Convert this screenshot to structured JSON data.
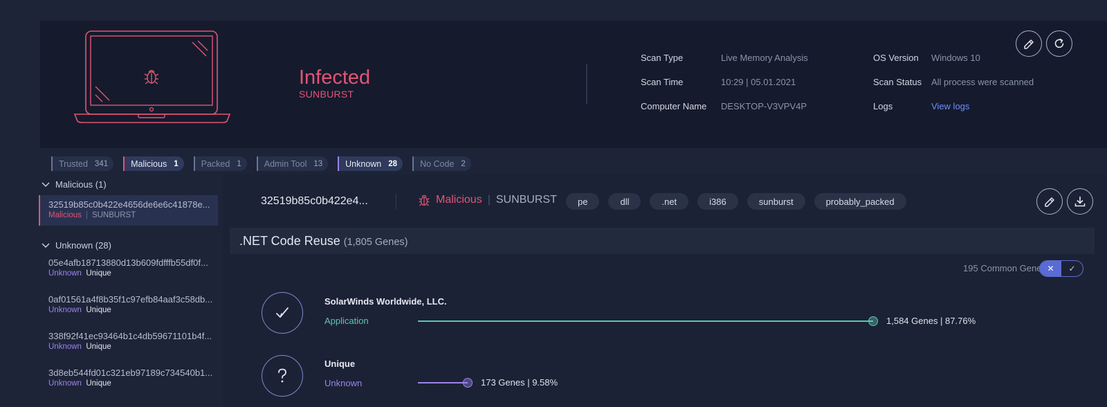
{
  "scan": {
    "verdict": "Infected",
    "family": "SUNBURST",
    "fields": {
      "scan_type_label": "Scan Type",
      "scan_type_value": "Live Memory Analysis",
      "scan_time_label": "Scan Time",
      "scan_time_value": "10:29 | 05.01.2021",
      "computer_name_label": "Computer Name",
      "computer_name_value": "DESKTOP-V3VPV4P",
      "os_version_label": "OS Version",
      "os_version_value": "Windows 10",
      "scan_status_label": "Scan Status",
      "scan_status_value": "All process were scanned",
      "logs_label": "Logs",
      "logs_link": "View logs"
    }
  },
  "filters": [
    {
      "label": "Trusted",
      "count": "341"
    },
    {
      "label": "Malicious",
      "count": "1"
    },
    {
      "label": "Packed",
      "count": "1"
    },
    {
      "label": "Admin Tool",
      "count": "13"
    },
    {
      "label": "Unknown",
      "count": "28"
    },
    {
      "label": "No Code",
      "count": "2"
    }
  ],
  "sidebar": {
    "malicious_group": "Malicious (1)",
    "malicious_items": [
      {
        "hash": "32519b85c0b422e4656de6e6c41878e...",
        "tag": "Malicious",
        "family": "SUNBURST"
      }
    ],
    "unknown_group": "Unknown (28)",
    "unknown_items": [
      {
        "hash": "05e4afb18713880d13b609fdfffb55df0f...",
        "tag": "Unknown",
        "sub": "Unique"
      },
      {
        "hash": "0af01561a4f8b35f1c97efb84aaf3c58db...",
        "tag": "Unknown",
        "sub": "Unique"
      },
      {
        "hash": "338f92f41ec93464b1c4db59671101b4f...",
        "tag": "Unknown",
        "sub": "Unique"
      },
      {
        "hash": "3d8eb544fd01c321eb97189c734540b1...",
        "tag": "Unknown",
        "sub": "Unique"
      }
    ]
  },
  "detail": {
    "hash": "32519b85c0b422e4...",
    "verdict": "Malicious",
    "family": "SUNBURST",
    "tags": [
      "pe",
      "dll",
      ".net",
      "i386",
      "sunburst",
      "probably_packed"
    ]
  },
  "reuse": {
    "title": ".NET Code Reuse",
    "count": "(1,805 Genes)",
    "common_genes": "195 Common Genes",
    "toggle_off": "✕",
    "toggle_on": "✓",
    "rows": [
      {
        "name": "SolarWinds Worldwide, LLC.",
        "type": "Application",
        "label": "1,584 Genes | 87.76%",
        "fraction": 0.8776,
        "color": "#5ec6b0"
      },
      {
        "name": "Unique",
        "type": "Unknown",
        "label": "173 Genes | 9.58%",
        "fraction": 0.0958,
        "color": "#9c83ea"
      }
    ]
  },
  "icons": {
    "laptop": "laptop-icon",
    "bug": "bug-icon",
    "edit": "edit-icon",
    "refresh": "refresh-icon",
    "download": "download-icon",
    "check": "check-icon",
    "question": "question-icon",
    "chevron": "chevron-down-icon"
  },
  "colors": {
    "malicious": "#e25477",
    "unknown": "#9c83ea",
    "application": "#5ec6b0",
    "link": "#6f8bff"
  }
}
